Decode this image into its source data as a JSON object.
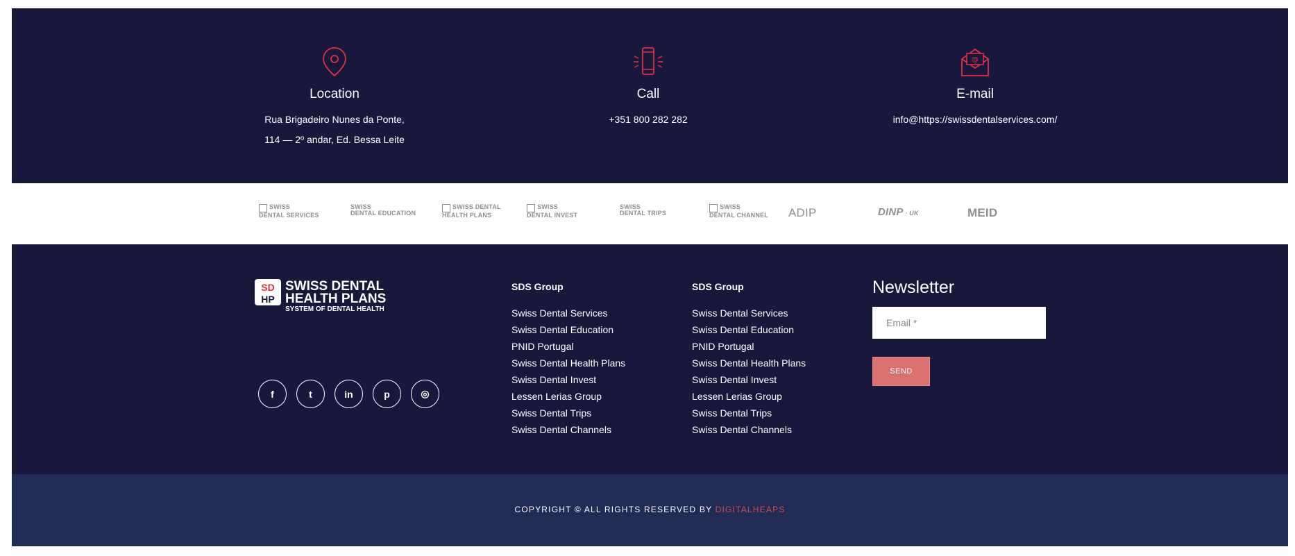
{
  "contact": {
    "location": {
      "title": "Location",
      "line1": "Rua Brigadeiro Nunes da Ponte,",
      "line2": "114 — 2º andar, Ed. Bessa Leite"
    },
    "call": {
      "title": "Call",
      "line1": "+351 800 282 282"
    },
    "email": {
      "title": "E-mail",
      "line1": "info@https://swissdentalservices.com/"
    }
  },
  "partners": [
    {
      "name": "SWISS DENTAL SERVICES",
      "line1": "SWISS",
      "line2": "DENTAL SERVICES"
    },
    {
      "name": "SWISS DENTAL EDUCATION",
      "line1": "SWISS",
      "line2": "DENTAL EDUCATION"
    },
    {
      "name": "SWISS DENTAL HEALTH PLANS",
      "line1": "SWISS DENTAL",
      "line2": "HEALTH PLANS"
    },
    {
      "name": "SWISS DENTAL INVEST",
      "line1": "SWISS",
      "line2": "DENTAL INVEST"
    },
    {
      "name": "SWISS DENTAL TRIPS",
      "line1": "SWISS",
      "line2": "DENTAL TRIPS"
    },
    {
      "name": "SWISS DENTAL CHANNEL",
      "line1": "SWISS",
      "line2": "DENTAL CHANNEL"
    },
    {
      "name": "ADIP",
      "line1": "ADIP",
      "line2": ""
    },
    {
      "name": "DINP UK",
      "line1": "DINP",
      "line2": "UK"
    },
    {
      "name": "MEID",
      "line1": "MEID",
      "line2": ""
    }
  ],
  "brand": {
    "line1": "SWISS DENTAL",
    "line2": "HEALTH PLANS",
    "tagline": "SYSTEM OF DENTAL HEALTH",
    "mono_top": "SD",
    "mono_bottom": "HP"
  },
  "social": [
    {
      "icon": "facebook-icon",
      "glyph": "f"
    },
    {
      "icon": "twitter-icon",
      "glyph": "t"
    },
    {
      "icon": "linkedin-icon",
      "glyph": "in"
    },
    {
      "icon": "pinterest-icon",
      "glyph": "p"
    },
    {
      "icon": "dribbble-icon",
      "glyph": "◎"
    }
  ],
  "columns": [
    {
      "title": "SDS Group",
      "items": [
        "Swiss Dental Services",
        "Swiss Dental Education",
        "PNID Portugal",
        "Swiss Dental Health Plans",
        "Swiss Dental Invest",
        "Lessen Lerias Group",
        "Swiss Dental Trips",
        "Swiss Dental Channels"
      ]
    },
    {
      "title": "SDS Group",
      "items": [
        "Swiss Dental Services",
        "Swiss Dental Education",
        "PNID Portugal",
        "Swiss Dental Health Plans",
        "Swiss Dental Invest",
        "Lessen Lerias Group",
        "Swiss Dental Trips",
        "Swiss Dental Channels"
      ]
    }
  ],
  "newsletter": {
    "title": "Newsletter",
    "placeholder": "Email *",
    "button": "SEND"
  },
  "copyright": {
    "text": "COPYRIGHT © ALL RIGHTS RESERVED BY ",
    "brand": "DIGITALHEAPS"
  },
  "colors": {
    "navy": "#18183d",
    "bottom_bar": "#212c54",
    "accent": "#d94a4f",
    "send_button": "#d9716f",
    "icon_red": "#e0303f"
  }
}
